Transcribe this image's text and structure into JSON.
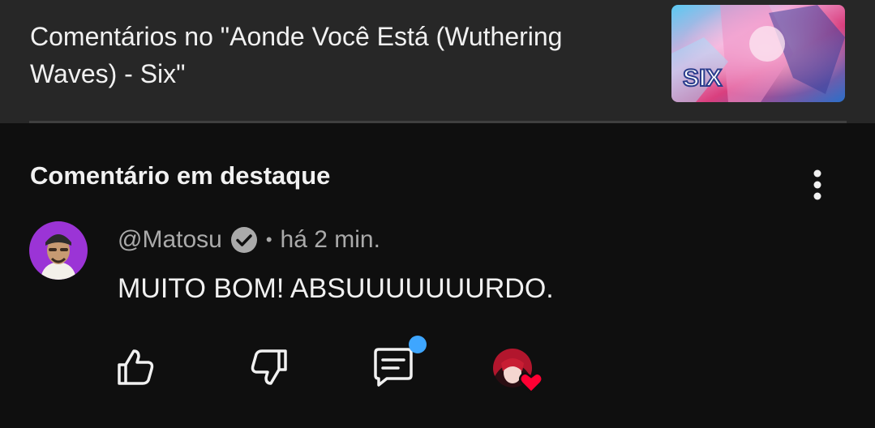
{
  "header": {
    "title": "Comentários no \"Aonde Você Está (Wuthering Waves) - Six\"",
    "thumbnail_text": "SIX"
  },
  "featured": {
    "section_title": "Comentário em destaque"
  },
  "comment": {
    "author": "@Matosu",
    "time": "há 2 min.",
    "separator": "•",
    "text": "MUITO BOM! ABSUUUUUUURDO."
  },
  "actions": {
    "like_icon": "thumbs-up-icon",
    "dislike_icon": "thumbs-down-icon",
    "reply_icon": "reply-icon",
    "heart_icon": "creator-heart-icon"
  },
  "colors": {
    "background": "#0f0f0f",
    "header_bg": "#272727",
    "notification_dot": "#3ea6ff",
    "heart": "#ff0033"
  }
}
